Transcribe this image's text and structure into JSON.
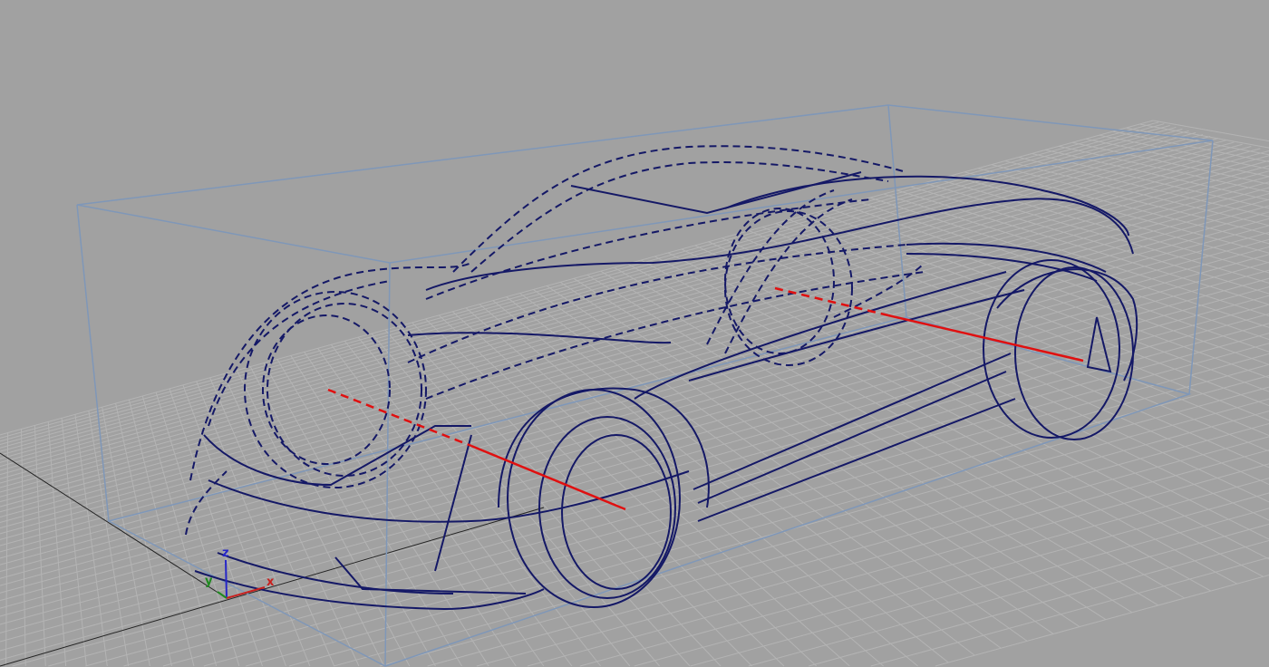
{
  "viewport": {
    "background": "#a1a1a1",
    "grid_color": "#b4b4b4",
    "bbox_color": "#7f97b8",
    "curve_color": "#141866",
    "axle_color": "#e01010"
  },
  "axis_gizmo": {
    "x_label": "x",
    "y_label": "y",
    "z_label": "z",
    "x_color": "#c8201e",
    "y_color": "#1f8a1f",
    "z_color": "#2626c8"
  }
}
